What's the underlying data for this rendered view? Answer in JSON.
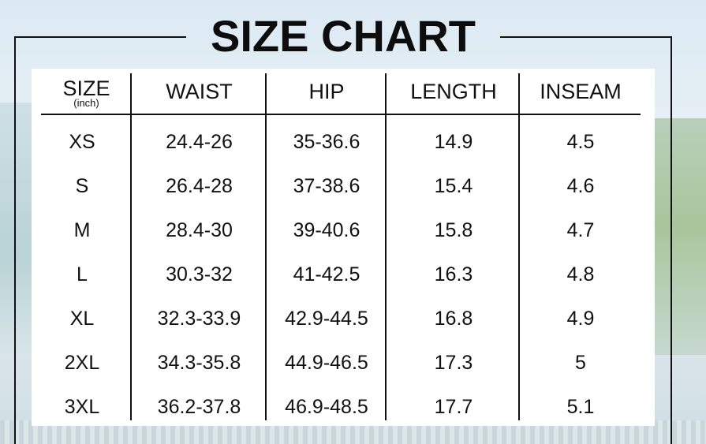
{
  "title": "SIZE CHART",
  "table": {
    "headers": {
      "size": "SIZE",
      "size_unit": "(inch)",
      "waist": "WAIST",
      "hip": "HIP",
      "length": "LENGTH",
      "inseam": "INSEAM"
    },
    "rows": [
      {
        "size": "XS",
        "waist": "24.4-26",
        "hip": "35-36.6",
        "length": "14.9",
        "inseam": "4.5"
      },
      {
        "size": "S",
        "waist": "26.4-28",
        "hip": "37-38.6",
        "length": "15.4",
        "inseam": "4.6"
      },
      {
        "size": "M",
        "waist": "28.4-30",
        "hip": "39-40.6",
        "length": "15.8",
        "inseam": "4.7"
      },
      {
        "size": "L",
        "waist": "30.3-32",
        "hip": "41-42.5",
        "length": "16.3",
        "inseam": "4.8"
      },
      {
        "size": "XL",
        "waist": "32.3-33.9",
        "hip": "42.9-44.5",
        "length": "16.8",
        "inseam": "4.9"
      },
      {
        "size": "2XL",
        "waist": "34.3-35.8",
        "hip": "44.9-46.5",
        "length": "17.3",
        "inseam": "5"
      },
      {
        "size": "3XL",
        "waist": "36.2-37.8",
        "hip": "46.9-48.5",
        "length": "17.7",
        "inseam": "5.1"
      }
    ]
  }
}
